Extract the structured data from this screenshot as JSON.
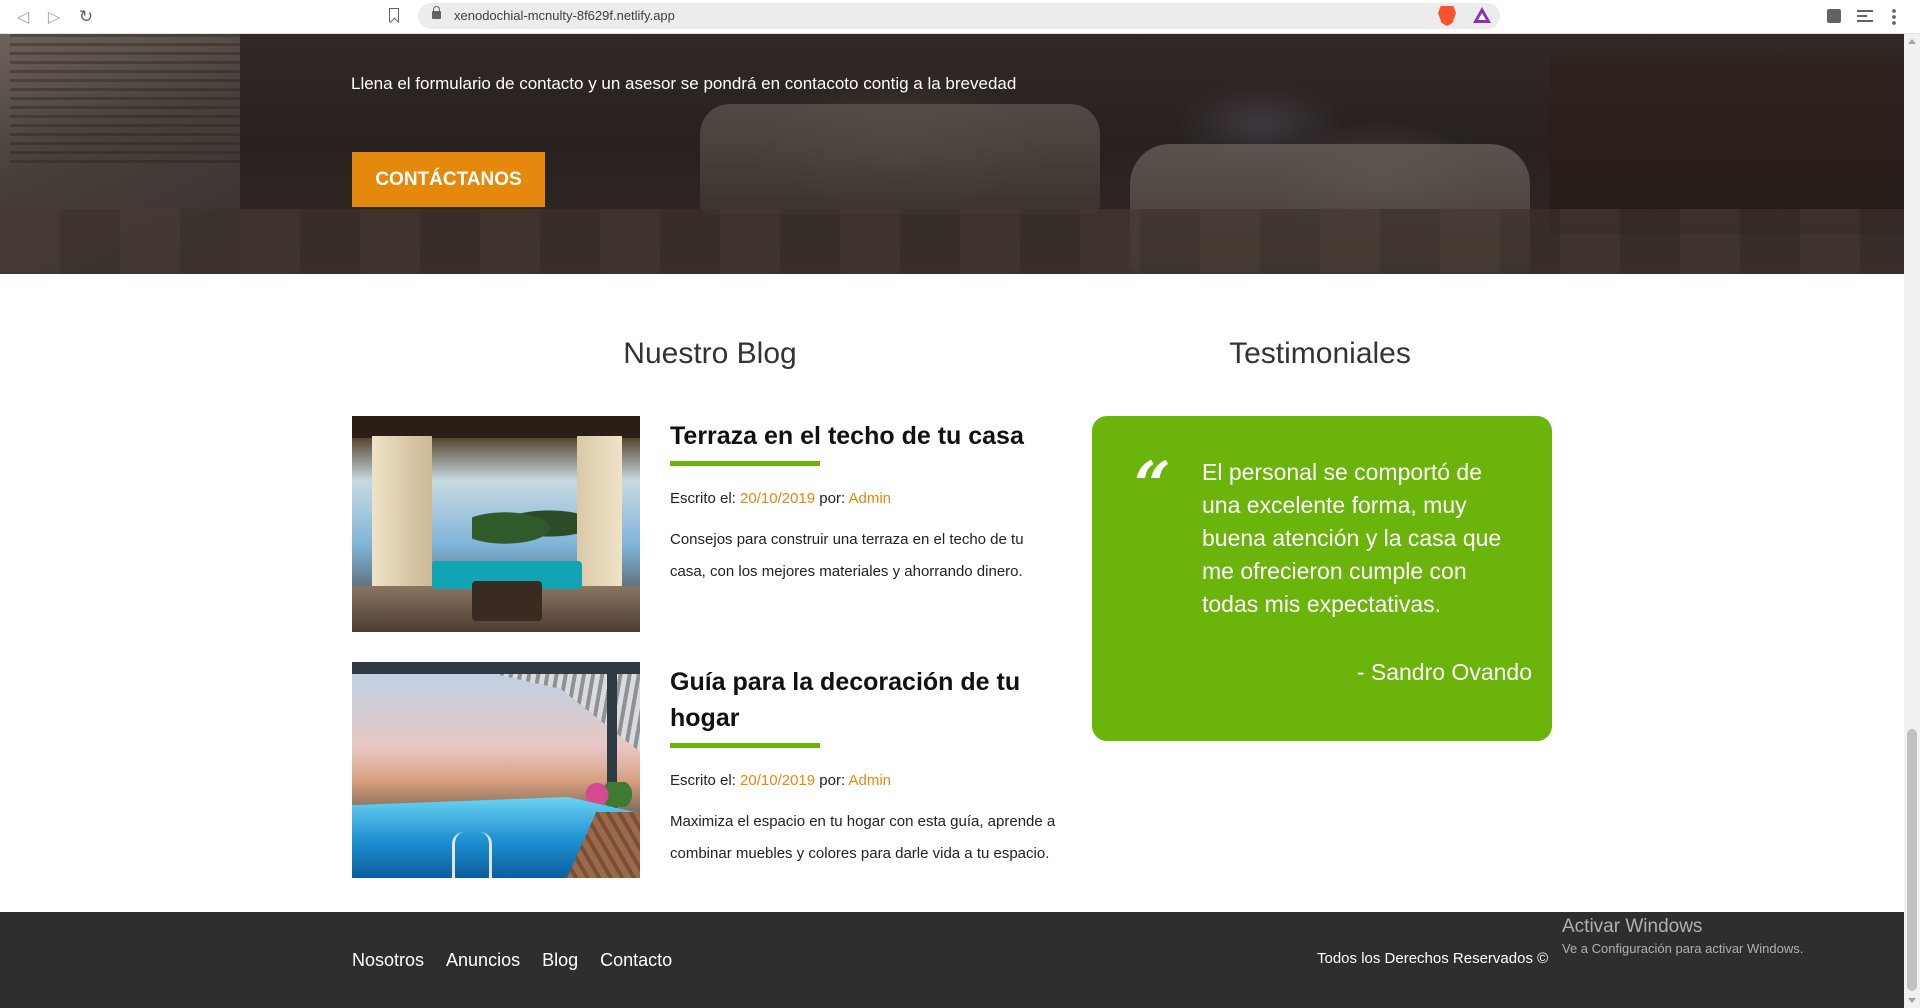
{
  "browser": {
    "url": "xenodochial-mcnulty-8f629f.netlify.app",
    "icons": [
      "back-icon",
      "forward-icon",
      "reload-icon",
      "bookmark-icon",
      "lock-icon",
      "brave-shield-icon",
      "brave-rewards-icon",
      "extensions-icon",
      "playlist-icon",
      "menu-icon"
    ]
  },
  "hero": {
    "text": "Llena el formulario de contacto y un asesor se pondrá en contacoto contig a la brevedad",
    "button_label": "CONTÁCTANOS"
  },
  "blog": {
    "heading": "Nuestro Blog",
    "posts": [
      {
        "title": "Terraza en el techo de tu casa",
        "meta_written": "Escrito el:",
        "date": "20/10/2019",
        "meta_by": "por:",
        "author": "Admin",
        "excerpt": "Consejos para construir una terraza en el techo de tu casa, con los mejores materiales y ahorrando dinero."
      },
      {
        "title": "Guía para la decoración de tu hogar",
        "meta_written": "Escrito el:",
        "date": "20/10/2019",
        "meta_by": "por:",
        "author": "Admin",
        "excerpt": "Maximiza el espacio en tu hogar con esta guía, aprende a combinar muebles y colores para darle vida a tu espacio."
      }
    ]
  },
  "testimonials": {
    "heading": "Testimoniales",
    "quote_mark": "“",
    "quote": "El personal se comportó de una excelente forma, muy buena atención y la casa que me ofrecieron cumple con todas mis expectativas.",
    "author": "- Sandro Ovando"
  },
  "footer": {
    "links": [
      "Nosotros",
      "Anuncios",
      "Blog",
      "Contacto"
    ],
    "copyright": "Todos los Derechos Reservados ©"
  },
  "watermark": {
    "title": "Activar Windows",
    "subtitle": "Ve a Configuración para activar Windows."
  },
  "colors": {
    "accent_orange": "#e4890b",
    "accent_green": "#6ab40b",
    "footer_bg": "#2e2e2e"
  }
}
